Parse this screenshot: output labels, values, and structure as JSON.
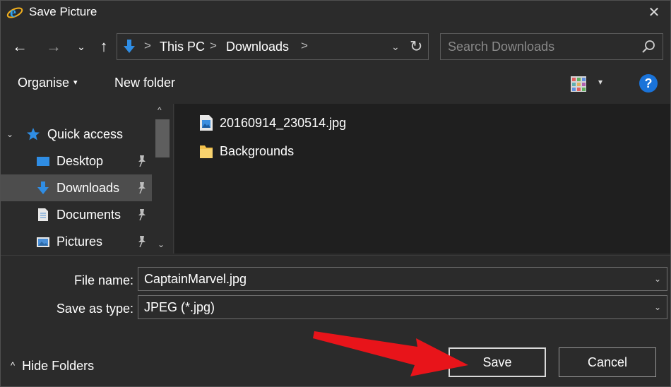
{
  "window": {
    "title": "Save Picture",
    "close_glyph": "✕"
  },
  "nav": {
    "back_glyph": "←",
    "forward_glyph": "→",
    "recent_glyph": "⌄",
    "up_glyph": "↑"
  },
  "address": {
    "crumbs": [
      "This PC",
      "Downloads"
    ],
    "separator": ">",
    "dropdown_glyph": "⌄",
    "refresh_glyph": "↻"
  },
  "search": {
    "placeholder": "Search Downloads"
  },
  "toolbar": {
    "organise_label": "Organise",
    "caret_glyph": "▾",
    "new_folder_label": "New folder",
    "view_dropdown_glyph": "▾",
    "help_glyph": "?"
  },
  "navpane": {
    "expander_glyph": "⌄",
    "quick_access_label": "Quick access",
    "items": [
      {
        "label": "Desktop",
        "icon": "desktop-icon",
        "pinned": true
      },
      {
        "label": "Downloads",
        "icon": "downloads-icon",
        "pinned": true,
        "selected": true
      },
      {
        "label": "Documents",
        "icon": "documents-icon",
        "pinned": true
      },
      {
        "label": "Pictures",
        "icon": "pictures-icon",
        "pinned": true
      }
    ],
    "scroll_up_glyph": "^",
    "scroll_down_glyph": "⌄"
  },
  "files": [
    {
      "name": "20160914_230514.jpg",
      "icon": "image-file-icon"
    },
    {
      "name": "Backgrounds",
      "icon": "folder-icon"
    }
  ],
  "form": {
    "file_name_label": "File name:",
    "file_name_value": "CaptainMarvel.jpg",
    "save_type_label": "Save as type:",
    "save_type_value": "JPEG (*.jpg)",
    "dropdown_glyph": "⌄"
  },
  "footer": {
    "hide_folders_glyph": "^",
    "hide_folders_label": "Hide Folders",
    "save_label": "Save",
    "cancel_label": "Cancel"
  },
  "colors": {
    "background": "#2b2b2b",
    "content_background": "#1f1f1f",
    "selected_item": "#4d4d4d",
    "accent_blue": "#1a73d9",
    "annotation_arrow": "#e8141a"
  }
}
